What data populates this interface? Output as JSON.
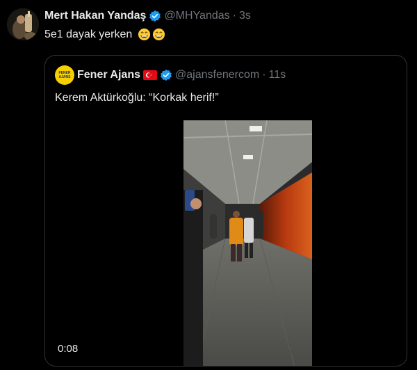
{
  "tweet": {
    "author_name": "Mert Hakan Yandaş",
    "handle": "@MHYandas",
    "separator": "·",
    "time": "3s",
    "text": "5e1 dayak yerken"
  },
  "quote": {
    "author_name": "Fener Ajans",
    "avatar_text": [
      "FENER",
      "AJANS"
    ],
    "handle": "@ajansfenercom",
    "separator": "·",
    "time": "11s",
    "text": "Kerem Aktürkoğlu: “Korkak herif!”",
    "video_duration": "0:08"
  },
  "colors": {
    "verified": "#1d9bf0",
    "muted": "#71767b",
    "text": "#e7e9ea",
    "border": "#2f3336"
  },
  "icons": [
    "verified-badge-icon",
    "grinning-emoji-icon",
    "turkey-flag-icon"
  ]
}
